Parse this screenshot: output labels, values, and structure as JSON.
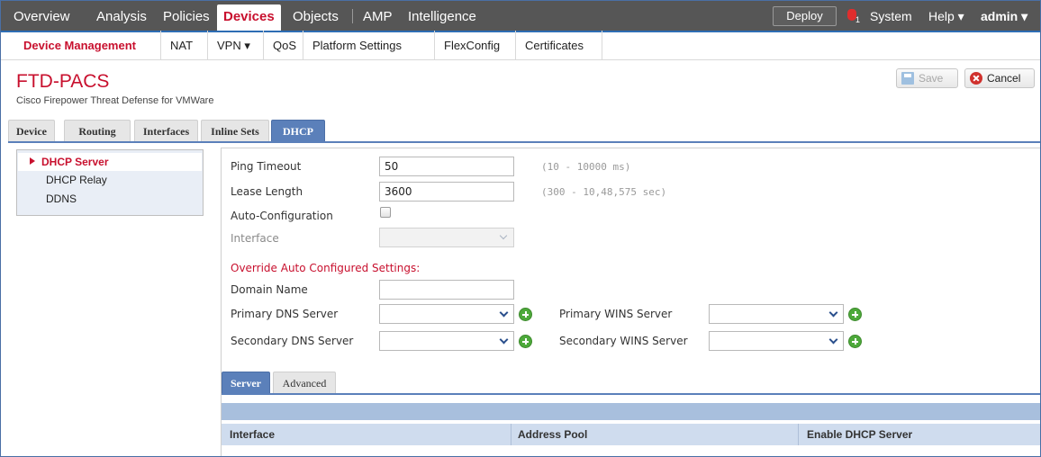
{
  "topnav": {
    "items": [
      "Overview",
      "Analysis",
      "Policies",
      "Devices",
      "Objects",
      "AMP",
      "Intelligence"
    ],
    "active": "Devices",
    "deploy_label": "Deploy",
    "alert_count": "1",
    "system_label": "System",
    "help_label": "Help ▾",
    "user_label": "admin ▾"
  },
  "subnav": {
    "items": [
      "Device Management",
      "NAT",
      "VPN ▾",
      "QoS",
      "Platform Settings",
      "FlexConfig",
      "Certificates"
    ],
    "active": "Device Management"
  },
  "header": {
    "title": "FTD-PACS",
    "subtitle": "Cisco Firepower Threat Defense for VMWare",
    "save_label": "Save",
    "cancel_label": "Cancel"
  },
  "page_tabs": {
    "items": [
      "Device",
      "Routing",
      "Interfaces",
      "Inline Sets",
      "DHCP"
    ],
    "active": "DHCP"
  },
  "left_menu": {
    "items": [
      "DHCP Server",
      "DHCP Relay",
      "DDNS"
    ],
    "active": "DHCP Server"
  },
  "form": {
    "ping_timeout_label": "Ping Timeout",
    "ping_timeout_value": "50",
    "ping_timeout_hint": "(10 - 10000 ms)",
    "lease_length_label": "Lease Length",
    "lease_length_value": "3600",
    "lease_length_hint": "(300 - 10,48,575 sec)",
    "auto_config_label": "Auto-Configuration",
    "auto_config_checked": false,
    "interface_label": "Interface",
    "override_label": "Override Auto Configured Settings:",
    "domain_name_label": "Domain Name",
    "domain_name_value": "",
    "primary_dns_label": "Primary DNS Server",
    "secondary_dns_label": "Secondary DNS Server",
    "primary_wins_label": "Primary WINS Server",
    "secondary_wins_label": "Secondary WINS Server"
  },
  "bottom_tabs": {
    "items": [
      "Server",
      "Advanced"
    ],
    "active": "Server"
  },
  "table": {
    "columns": [
      "Interface",
      "Address Pool",
      "Enable DHCP Server"
    ]
  }
}
